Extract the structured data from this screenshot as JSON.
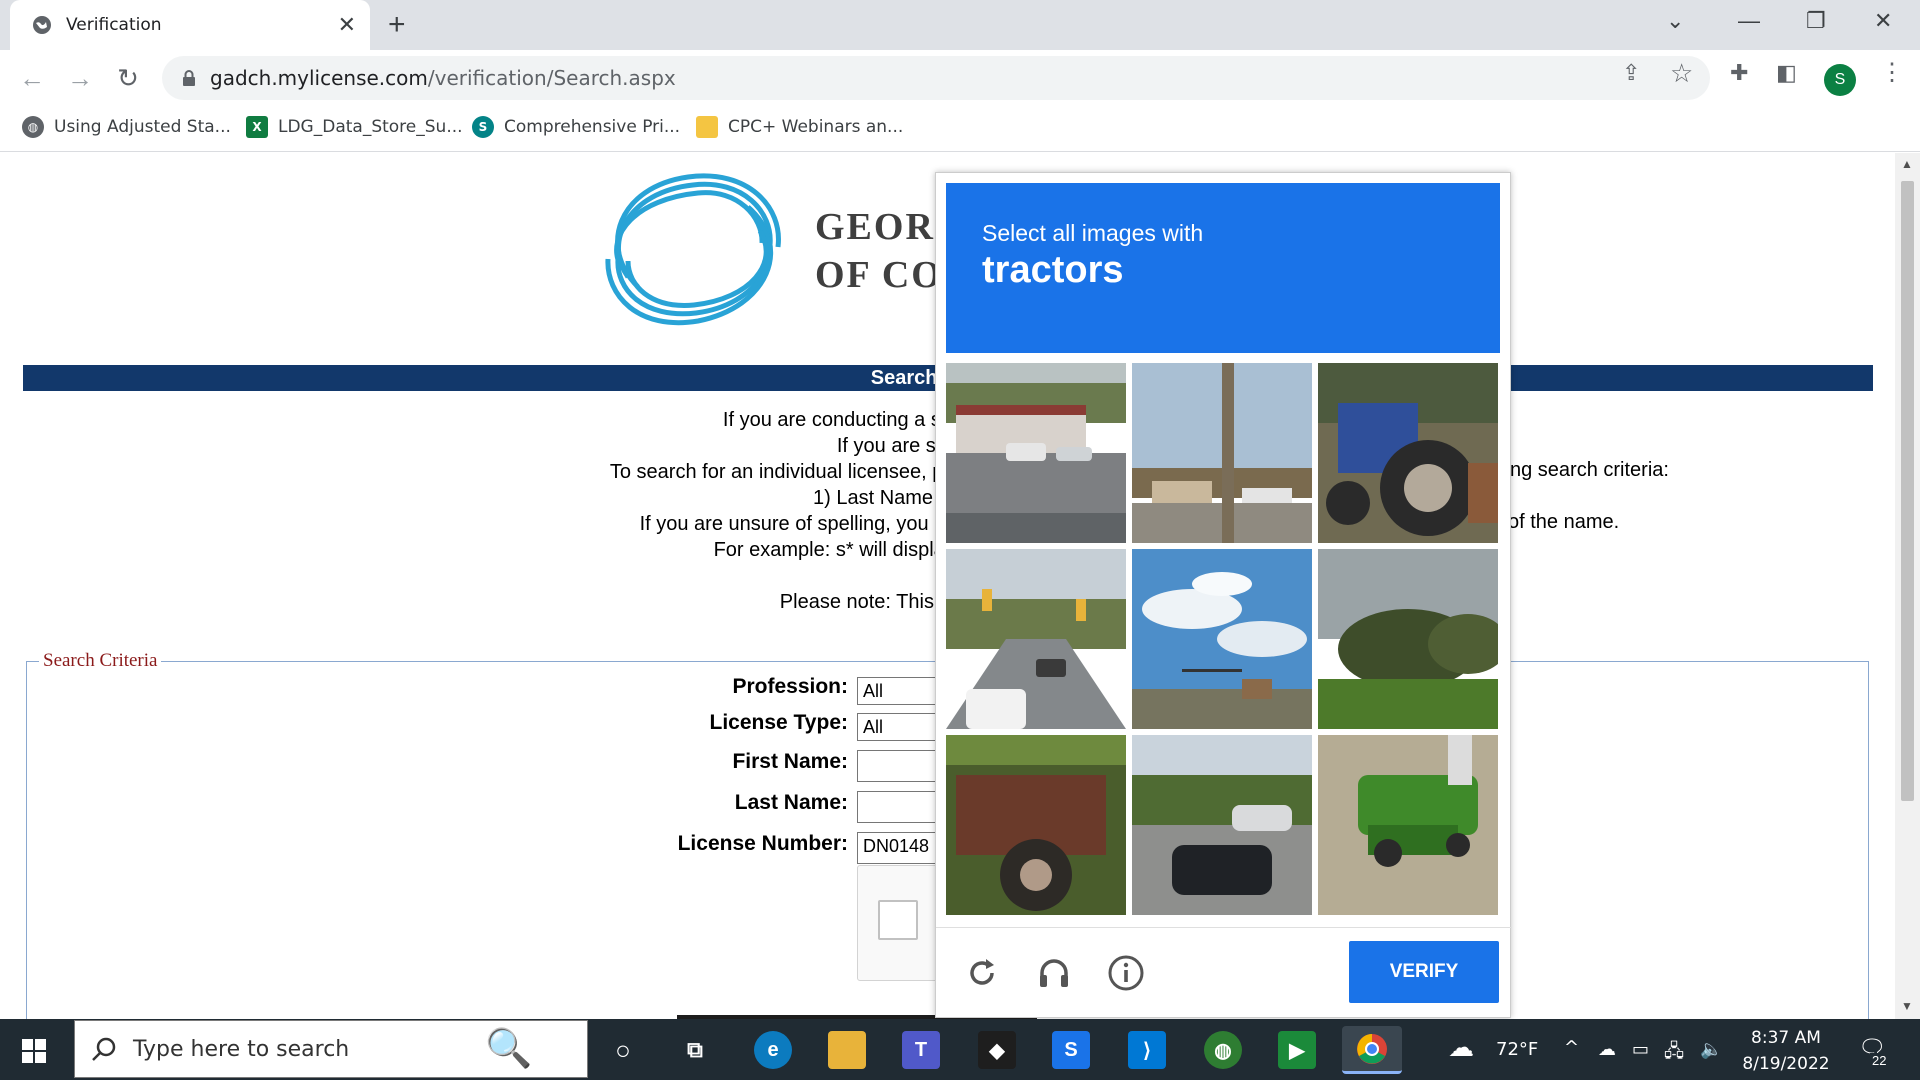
{
  "browser": {
    "tab_title": "Verification",
    "url_host": "gadch.mylicense.com",
    "url_path": "/verification/Search.aspx",
    "profile_initial": "S",
    "bookmarks": [
      {
        "label": "Using Adjusted Sta...",
        "icon": "globe-icon"
      },
      {
        "label": "LDG_Data_Store_Su...",
        "icon": "excel-icon"
      },
      {
        "label": "Comprehensive Pri...",
        "icon": "sharepoint-icon"
      },
      {
        "label": "CPC+ Webinars an...",
        "icon": "folder-icon"
      }
    ]
  },
  "page": {
    "org_name_line1": "GEOR",
    "org_name_line2": "OF CO",
    "banner_title": "Search for a Pro",
    "intro_lines": [
      "If you are conducting a search for an individual lice",
      "If you are searching for a",
      "To search for an individual licensee, please select a specific profession or \"A",
      "1) Last Name 2) Last Name ar",
      "If you are unsure of spelling, you may perform a wildcard search by pl",
      "For example: s* will display all names starting with 's'",
      "",
      "Please note: This web site is intended"
    ],
    "intro_right_1": "ng search criteria:",
    "intro_right_2": "of the name.",
    "fieldset_legend": "Search Criteria",
    "form": {
      "profession_label": "Profession:",
      "profession_value": "All",
      "license_type_label": "License Type:",
      "license_type_value": "All",
      "first_name_label": "First Name:",
      "first_name_value": "",
      "last_name_label": "Last Name:",
      "last_name_value": "",
      "license_number_label": "License Number:",
      "license_number_value": "DN0148"
    }
  },
  "challenge": {
    "instruction": "Select all images with",
    "target": "tractors",
    "verify_label": "VERIFY",
    "tiles": [
      "storefront-street",
      "utility-pole-lot",
      "blue-tractor",
      "busy-road",
      "sky-intersection",
      "trees-field",
      "rusty-machine",
      "parked-cars",
      "green-mower"
    ]
  },
  "taskbar": {
    "search_placeholder": "Type here to search",
    "weather": "72°F",
    "time": "8:37 AM",
    "date": "8/19/2022",
    "notification_count": "22"
  },
  "colors": {
    "accent_blue": "#1a73e8",
    "banner_navy": "#12386b",
    "legend_red": "#8b1a1a",
    "logo_cyan": "#29a3d6"
  }
}
